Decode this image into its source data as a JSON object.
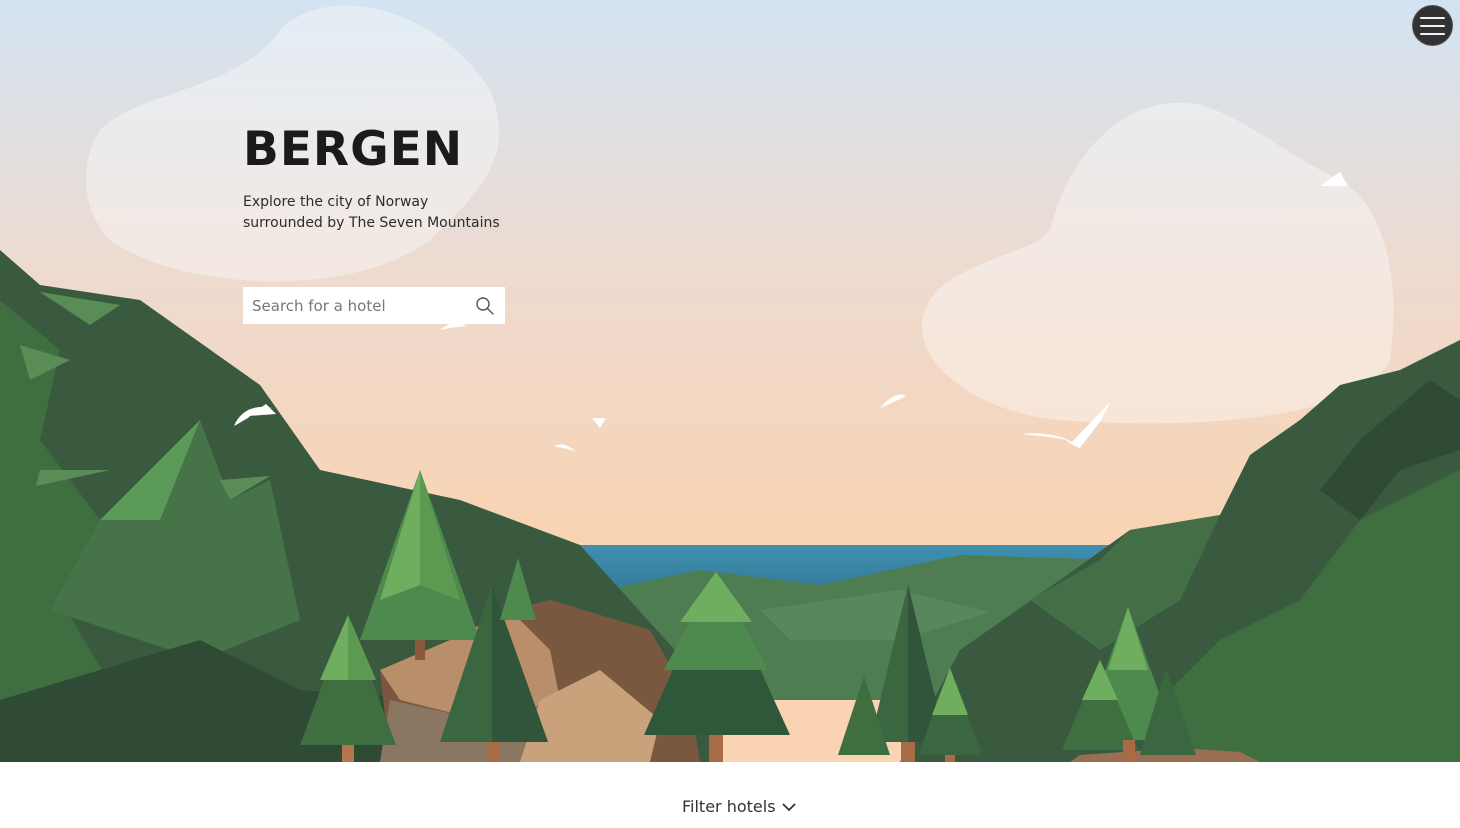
{
  "hero": {
    "title": "BERGEN",
    "subtitle": "Explore the city of Norway surrounded by The Seven Mountains"
  },
  "search": {
    "placeholder": "Search for a hotel",
    "icon": "search-icon"
  },
  "nav": {
    "menu_icon": "hamburger-menu-icon"
  },
  "filter": {
    "label": "Filter hotels",
    "icon": "chevron-down-icon"
  },
  "colors": {
    "sky_top": "#d3e3f1",
    "sky_bottom": "#f9d3b2",
    "mountain_dark": "#2f4a35",
    "mountain_light": "#3f6e41",
    "sea": "#3f8fb0",
    "rock": "#8a6a52",
    "menu_button": "#323234"
  }
}
